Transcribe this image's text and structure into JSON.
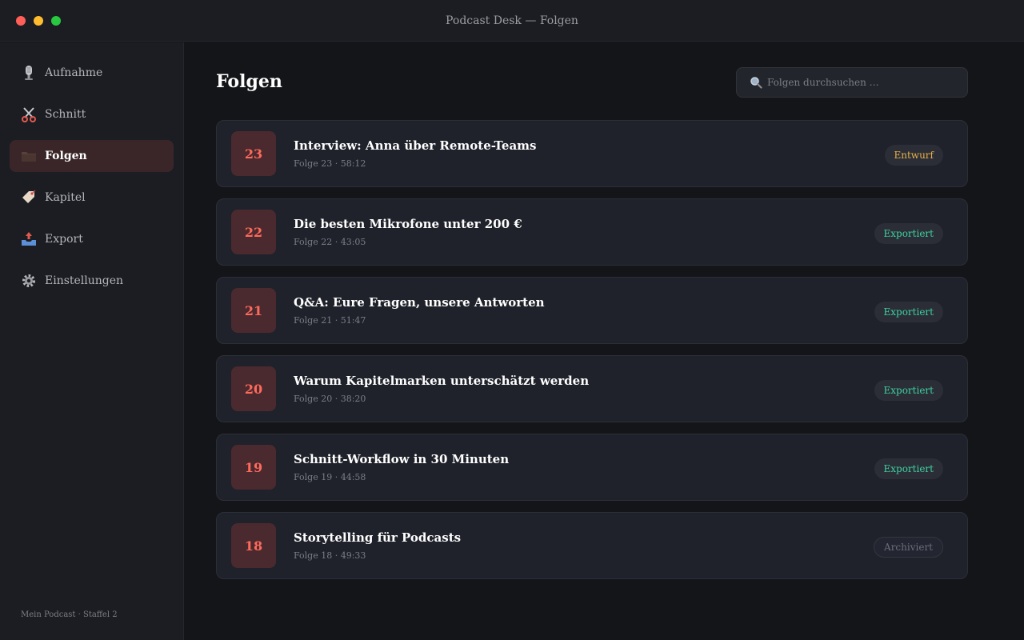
{
  "window": {
    "title": "Podcast Desk — Folgen"
  },
  "sidebar": {
    "items": [
      {
        "label": "Aufnahme",
        "icon": "microphone-icon",
        "active": false
      },
      {
        "label": "Schnitt",
        "icon": "scissors-icon",
        "active": false
      },
      {
        "label": "Folgen",
        "icon": "folder-icon",
        "active": true
      },
      {
        "label": "Kapitel",
        "icon": "tag-icon",
        "active": false
      },
      {
        "label": "Export",
        "icon": "outbox-tray-icon",
        "active": false
      },
      {
        "label": "Einstellungen",
        "icon": "gear-icon",
        "active": false
      }
    ],
    "footer": "Mein Podcast · Staffel 2"
  },
  "main": {
    "title": "Folgen",
    "search": {
      "placeholder": "Folgen durchsuchen …"
    },
    "episodes": [
      {
        "number": "23",
        "title": "Interview: Anna über Remote-Teams",
        "meta": "Folge 23 · 58:12",
        "status": "Entwurf",
        "status_kind": "draft"
      },
      {
        "number": "22",
        "title": "Die besten Mikrofone unter 200 €",
        "meta": "Folge 22 · 43:05",
        "status": "Exportiert",
        "status_kind": "exported"
      },
      {
        "number": "21",
        "title": "Q&A: Eure Fragen, unsere Antworten",
        "meta": "Folge 21 · 51:47",
        "status": "Exportiert",
        "status_kind": "exported"
      },
      {
        "number": "20",
        "title": "Warum Kapitelmarken unterschätzt werden",
        "meta": "Folge 20 · 38:20",
        "status": "Exportiert",
        "status_kind": "exported"
      },
      {
        "number": "19",
        "title": "Schnitt-Workflow in 30 Minuten",
        "meta": "Folge 19 · 44:58",
        "status": "Exportiert",
        "status_kind": "exported"
      },
      {
        "number": "18",
        "title": "Storytelling für Podcasts",
        "meta": "Folge 18 · 49:33",
        "status": "Archiviert",
        "status_kind": "archived"
      }
    ]
  },
  "colors": {
    "accent": "#ff6a5c",
    "draft": "#e8b04a",
    "exported": "#3ed1a0",
    "archived": "#6b6e77"
  }
}
